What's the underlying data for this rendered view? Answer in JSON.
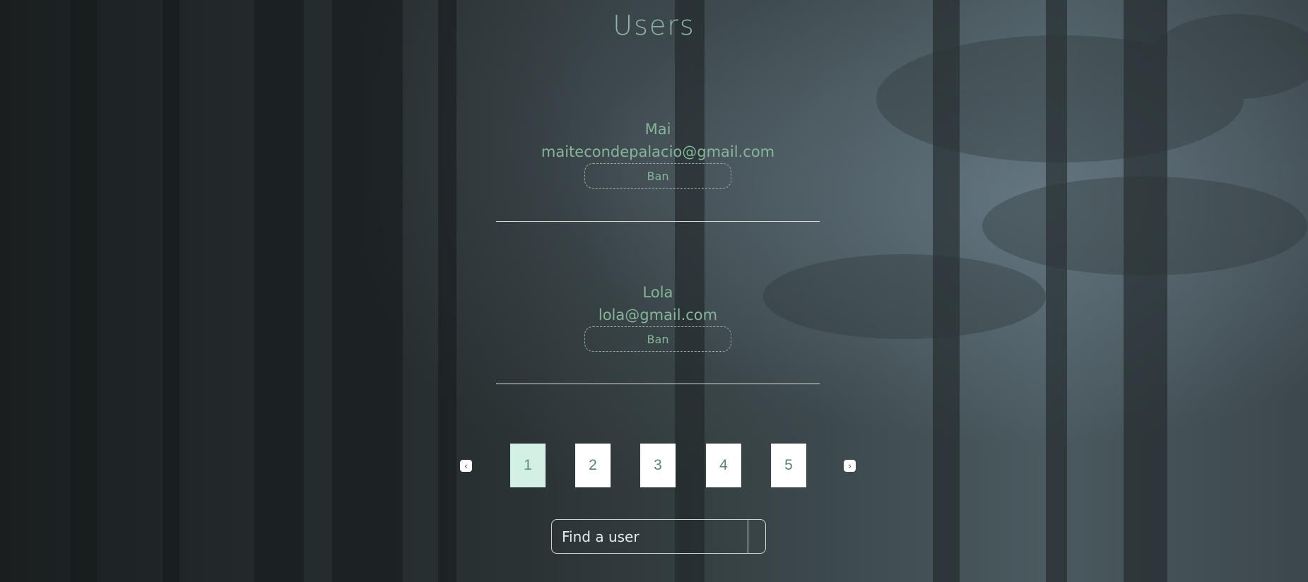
{
  "header": {
    "title": "Users"
  },
  "users": [
    {
      "name": "Mai",
      "email": "maitecondepalacio@gmail.com",
      "action_label": "Ban"
    },
    {
      "name": "Lola",
      "email": "lola@gmail.com",
      "action_label": "Ban"
    }
  ],
  "pagination": {
    "prev_glyph": "‹",
    "next_glyph": "›",
    "pages": [
      "1",
      "2",
      "3",
      "4",
      "5"
    ],
    "current_page": 1
  },
  "search": {
    "placeholder": "Find a user",
    "value": "",
    "icon": "search-icon"
  },
  "colors": {
    "accent_text": "#86b59a",
    "active_page_bg": "#d2f1e4",
    "divider": "#d8dcdb"
  }
}
